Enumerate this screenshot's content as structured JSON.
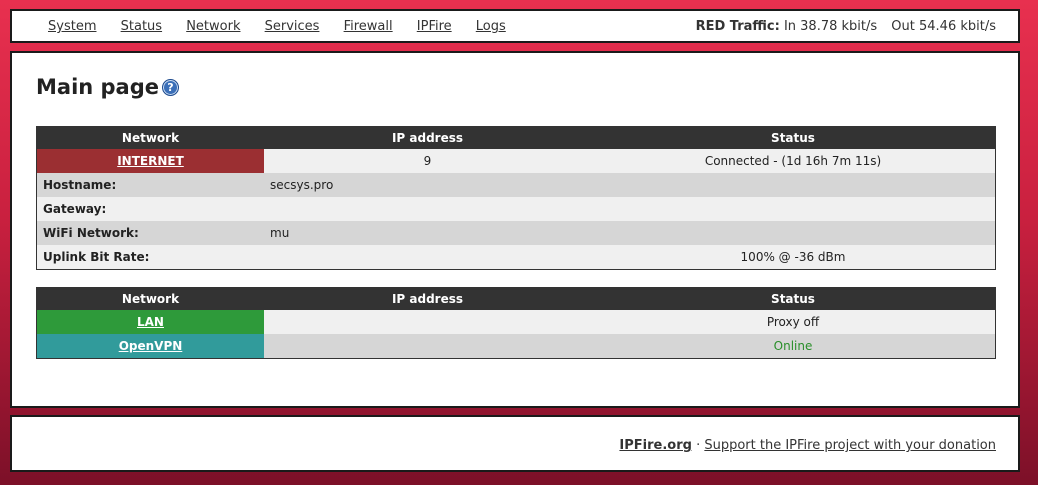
{
  "nav": {
    "items": [
      "System",
      "Status",
      "Network",
      "Services",
      "Firewall",
      "IPFire",
      "Logs"
    ]
  },
  "traffic": {
    "label": "RED Traffic:",
    "in": "In 38.78 kbit/s",
    "out": "Out 54.46 kbit/s"
  },
  "page": {
    "title": "Main page",
    "help_icon": "help-question-icon"
  },
  "red_table": {
    "headers": [
      "Network",
      "IP address",
      "Status"
    ],
    "interface": {
      "name": "INTERNET",
      "ip": "9",
      "status": "Connected - (1d 16h 7m 11s)",
      "color": "#9b2f32"
    },
    "rows": [
      {
        "label": "Hostname:",
        "value": "secsys.pro"
      },
      {
        "label": "Gateway:",
        "value": ""
      },
      {
        "label": "WiFi Network:",
        "value": "mu"
      },
      {
        "label": "Uplink Bit Rate:",
        "value": "100% @ -36 dBm"
      }
    ]
  },
  "local_table": {
    "headers": [
      "Network",
      "IP address",
      "Status"
    ],
    "rows": [
      {
        "name": "LAN",
        "ip": "",
        "status": "Proxy off",
        "color": "#2e9a3a"
      },
      {
        "name": "OpenVPN",
        "ip": "",
        "status": "Online",
        "color": "#319b9b",
        "status_color": "#2a8f2a"
      }
    ]
  },
  "footer": {
    "brand": "IPFire.org",
    "separator": "·",
    "donation": "Support the IPFire project with your donation"
  }
}
